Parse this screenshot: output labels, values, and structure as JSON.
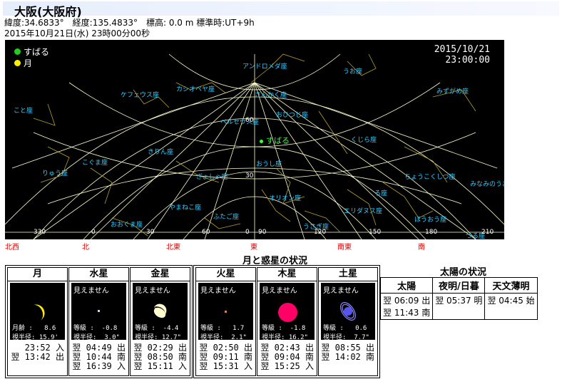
{
  "header": {
    "title": "大阪(大阪府)",
    "coords": "緯度:34.6833°　経度:135.4833°　標高: 0.0 m 標準時:UT+9h",
    "datetime": "2015年10月21日(水) 23時00分00秒"
  },
  "sky": {
    "legend": [
      {
        "label": "すばる",
        "color": "#22cc22"
      },
      {
        "label": "月",
        "color": "#ffee00"
      }
    ],
    "date": "2015/10/21",
    "time": "23:00:00",
    "subaru_label": "すばる",
    "constellations": [
      "アンドロメダ座",
      "うお座",
      "ケフェウス座",
      "カシオペヤ座",
      "さんかく座",
      "みずがめ座",
      "こと座",
      "おひつじ座",
      "ペルセウス座",
      "くじら座",
      "きりん座",
      "りゅう座",
      "こぐま座",
      "ぎょしゃ座",
      "おうし座",
      "ちょうこくしつ座",
      "みなみのうお座",
      "ろ座",
      "オリオン座",
      "やまねこ座",
      "ふたご座",
      "エリダヌス座",
      "おおぐま座",
      "うさぎ座",
      "ほうおう座",
      "つる座"
    ],
    "alt_labels": [
      "60",
      "30"
    ],
    "az_labels": [
      "330",
      "0",
      "30",
      "60",
      "0",
      "90",
      "120",
      "150",
      "180",
      "210"
    ],
    "directions": [
      "北西",
      "北",
      "北東",
      "東",
      "南東",
      "南"
    ]
  },
  "section_title": "月と惑星の状況",
  "planets": [
    {
      "name": "月",
      "visible_text": "",
      "stats": "月齢 :   8.6\n視半径: 15.9'",
      "events": "23:52 入\n翌 13:42 出"
    },
    {
      "name": "水星",
      "visible_text": "見えません",
      "stats": "等級 :  -0.8\n視半径:  3.0\"",
      "events": "翌 04:49 出\n翌 10:44 南\n翌 16:39 入"
    },
    {
      "name": "金星",
      "visible_text": "見えません",
      "stats": "等級 :  -4.4\n視半径: 12.7\"",
      "events": "翌 02:29 出\n翌 08:50 南\n翌 15:11 入"
    },
    {
      "name": "火星",
      "visible_text": "見えません",
      "stats": "等級 :   1.7\n視半径:  2.1\"",
      "events": "翌 02:50 出\n翌 09:11 南\n翌 15:31 入"
    },
    {
      "name": "木星",
      "visible_text": "見えません",
      "stats": "等級 :  -1.8\n視半径: 16.2\"",
      "events": "翌 02:43 出\n翌 09:04 南\n翌 15:25 入"
    },
    {
      "name": "土星",
      "visible_text": "見えません",
      "stats": "等級 :   0.6\n視半径:  7.7\"",
      "events": "翌 08:55 出\n翌 14:02 南"
    }
  ],
  "sun": {
    "title": "太陽の状況",
    "headers": [
      "太陽",
      "夜明/日暮",
      "天文薄明"
    ],
    "col1": [
      "翌 06:09 出",
      "翌 11:43 南"
    ],
    "col2": "翌 05:37 明",
    "col3": "翌 04:45 始"
  },
  "colors": {
    "grid": "#ffffcc",
    "constellation": "#33ccff",
    "figure": "#b5a030",
    "direction": "#dd0000"
  }
}
